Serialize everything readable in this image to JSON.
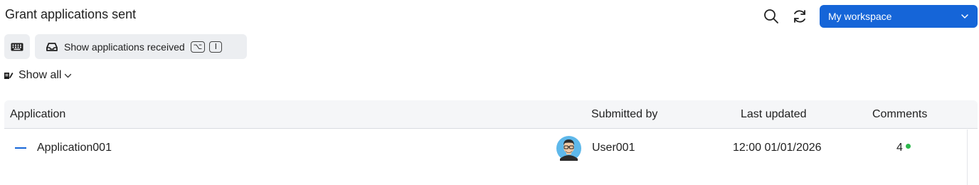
{
  "header": {
    "title": "Grant applications sent",
    "workspace": "My workspace"
  },
  "toolbar": {
    "received_label": "Show applications received",
    "shortcut_keys": [
      "⌥",
      "I"
    ]
  },
  "filter": {
    "label": "Show all"
  },
  "table": {
    "columns": [
      "Application",
      "Submitted by",
      "Last updated",
      "Comments"
    ],
    "rows": [
      {
        "application": "Application001",
        "submitted_by": "User001",
        "last_updated": "12:00 01/01/2026",
        "comments": "4"
      }
    ]
  },
  "colors": {
    "accent": "#1565d8",
    "comment_dot": "#2db84d",
    "header_bg": "#f5f6f8"
  }
}
